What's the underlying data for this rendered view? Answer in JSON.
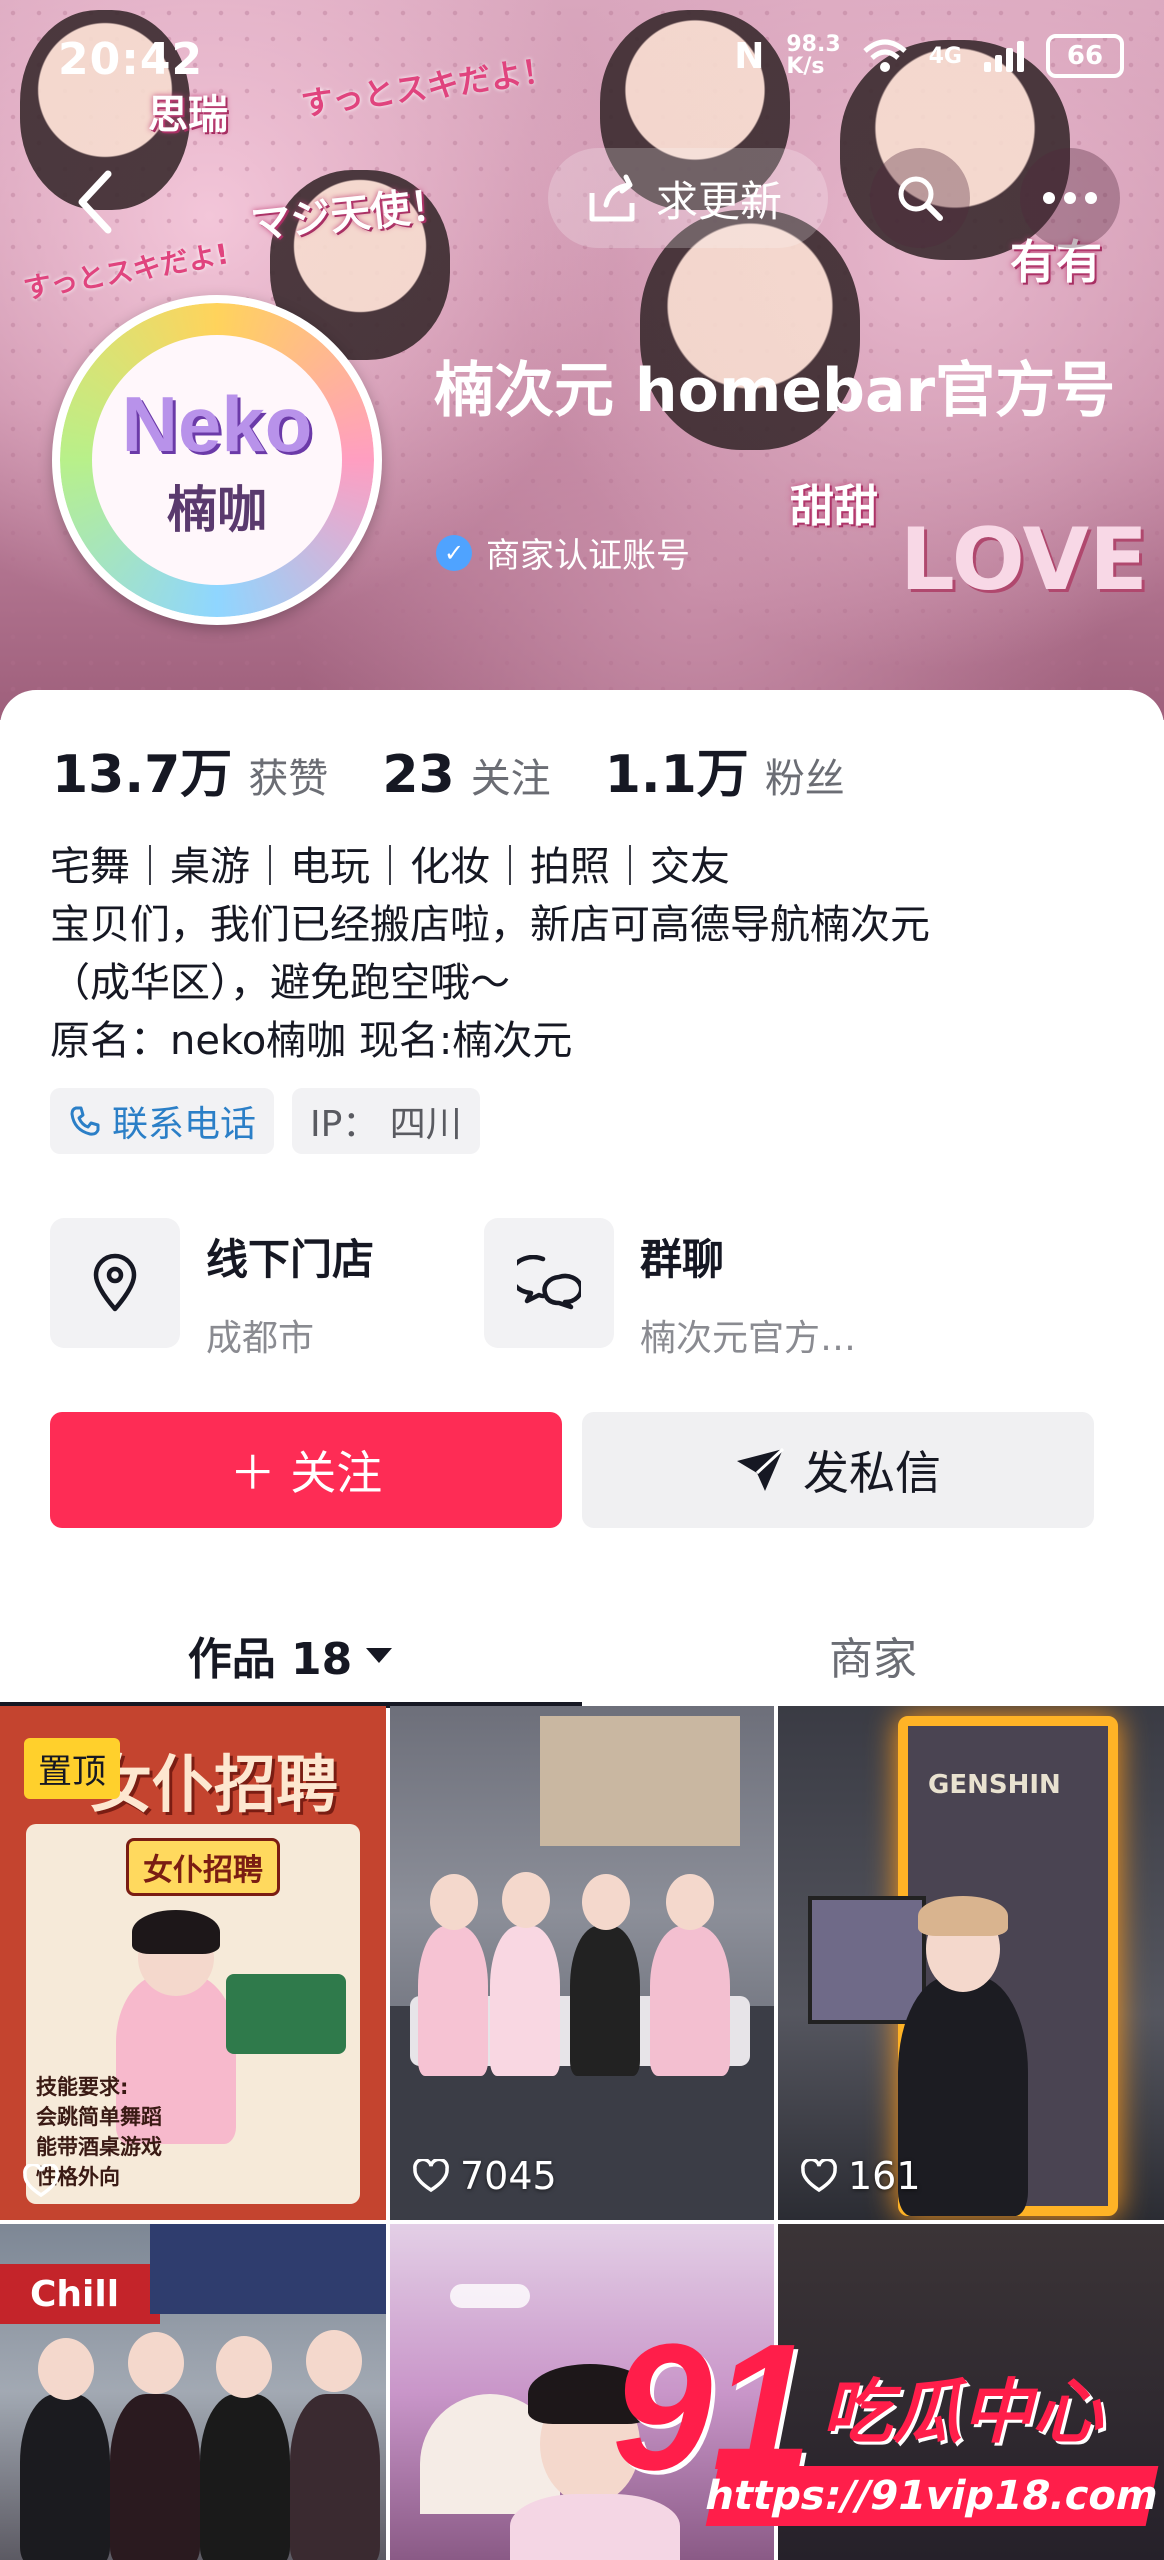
{
  "status_bar": {
    "time": "20:42",
    "nfc": "N",
    "network_speed": "98.3",
    "network_unit": "K/s",
    "signal": "4G",
    "battery": "66"
  },
  "header": {
    "update_label": "求更新",
    "banner_stickers": [
      "思瑞",
      "マジ天使！",
      "すっとスキだよ！",
      "有有",
      "甜甜",
      "LOVE",
      "すっとスキだよ!"
    ],
    "avatar_text": "Neko",
    "avatar_subtext": "楠咖",
    "name": "楠次元 homebar官方号",
    "verified_label": "商家认证账号"
  },
  "stats": [
    {
      "value": "13.7万",
      "label": "获赞"
    },
    {
      "value": "23",
      "label": "关注"
    },
    {
      "value": "1.1万",
      "label": "粉丝"
    }
  ],
  "bio": {
    "line1": "宅舞｜桌游｜电玩｜化妆｜拍照｜交友",
    "line2": "宝贝们，我们已经搬店啦，新店可高德导航楠次元",
    "line3": "（成华区），避免跑空哦～",
    "line4": "原名：neko楠咖 现名:楠次元"
  },
  "tags": {
    "phone": "联系电话",
    "ip": "IP：  四川"
  },
  "shops": [
    {
      "title": "线下门店",
      "subtitle": "成都市",
      "icon": "location-pin-icon"
    },
    {
      "title": "群聊",
      "subtitle": "楠次元官方…",
      "icon": "chat-bubbles-icon"
    }
  ],
  "actions": {
    "follow": "＋ 关注",
    "message": "发私信"
  },
  "tabs": {
    "works": "作品 18",
    "merchant": "商家"
  },
  "grid": {
    "pinned_label": "置顶",
    "cell1_title": "女仆招聘",
    "cell1_banner": "女仆招聘",
    "cell1_req": "技能要求:",
    "cell1_req1": "会跳简单舞蹈",
    "cell1_req2": "能带酒桌游戏",
    "cell1_req3": "性格外向",
    "cell2_likes": "7045",
    "cell3_likes": "161",
    "cell3_sign": "GENSHIN",
    "cell4_sign": "Chill"
  },
  "watermark": {
    "brand_num": "91",
    "brand_text": "吃瓜中心",
    "url": "https://91vip18.com"
  },
  "colors": {
    "accent": "#fe2c55",
    "link": "#2b7fc7",
    "pin": "#ffd02c"
  }
}
